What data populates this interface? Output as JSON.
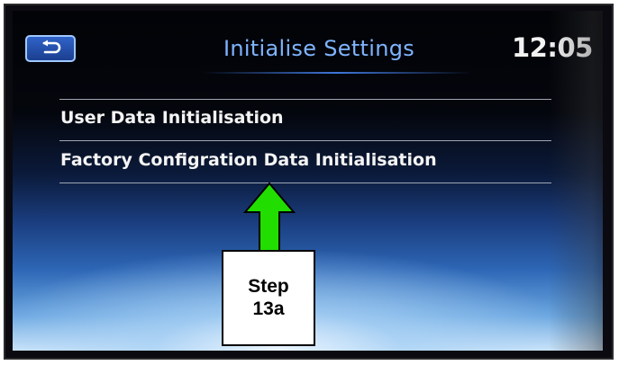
{
  "screen": {
    "title": "Initialise Settings",
    "clock": "12:05",
    "back_icon": "back-arrow-icon",
    "menu_items": [
      {
        "label": "User Data Initialisation"
      },
      {
        "label": "Factory Configration Data Initialisation"
      }
    ]
  },
  "annotation": {
    "step_line1": "Step",
    "step_line2": "13a",
    "arrow_color": "#22dd00"
  },
  "colors": {
    "title": "#7fb4ff",
    "back_button": "#2f63c8",
    "menu_text": "#f4f4f4"
  }
}
